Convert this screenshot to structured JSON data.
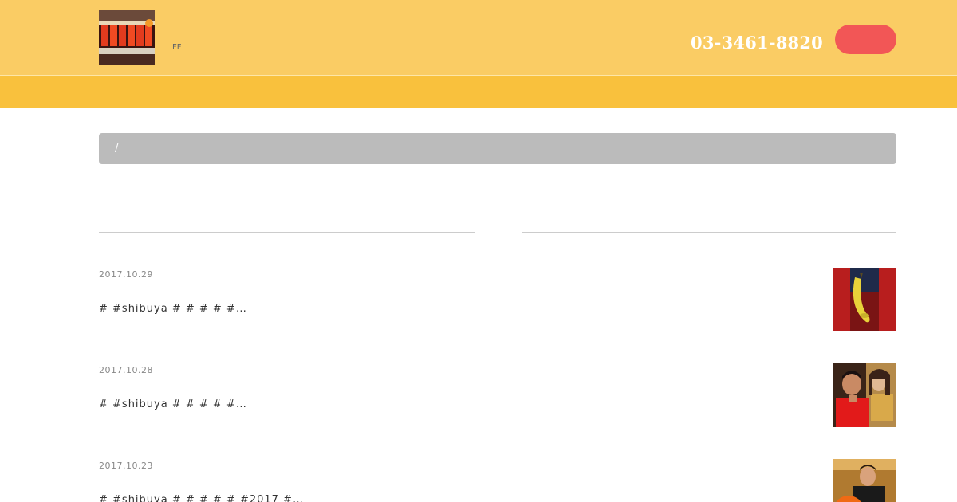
{
  "header": {
    "tagline": "FF",
    "phone": "03-3461-8820",
    "cta_label": "",
    "colors": {
      "top": "#facc64",
      "nav": "#f9c13d",
      "cta": "#f25656"
    }
  },
  "breadcrumb": {
    "separator": "/"
  },
  "section": {
    "title": ""
  },
  "posts": [
    {
      "date": "2017.10.29",
      "title": "",
      "excerpt": "#  #shibuya #  #  #  #  #…",
      "thumb_icon": "banana-photo"
    },
    {
      "date": "2017.10.28",
      "title": "",
      "excerpt": "#  #shibuya #  #  #  #  #…",
      "thumb_icon": "people-photo"
    },
    {
      "date": "2017.10.23",
      "title": "",
      "excerpt": "#  #shibuya #  #  #  #  #  #2017 #…",
      "thumb_icon": "pumpkin-photo"
    }
  ]
}
